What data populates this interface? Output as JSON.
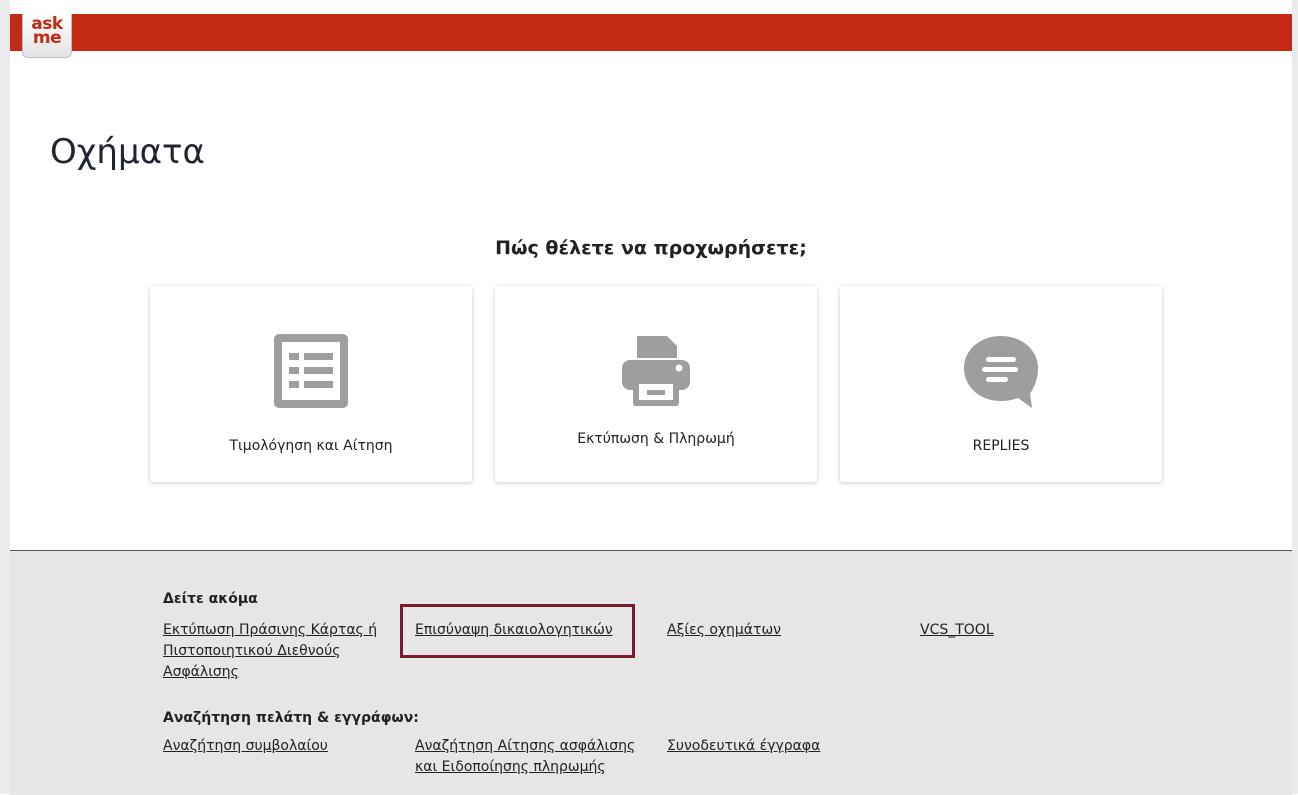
{
  "header": {
    "logo_text": "ask\nme",
    "brand_color": "#c52a16"
  },
  "page": {
    "title": "Οχήματα",
    "prompt": "Πώς θέλετε να προχωρήσετε;"
  },
  "cards": [
    {
      "label": "Τιμολόγηση και Αίτηση",
      "icon": "list-icon"
    },
    {
      "label": "Εκτύπωση & Πληρωμή",
      "icon": "printer-icon"
    },
    {
      "label": "REPLIES",
      "icon": "chat-bubble-icon"
    }
  ],
  "footer": {
    "see_also_heading": "Δείτε ακόμα",
    "see_also_links": [
      "Εκτύπωση Πράσινης Κάρτας ή Πιστοποιητικού Διεθνούς Ασφάλισης",
      "Επισύναψη δικαιολογητικών",
      "Αξίες οχημάτων",
      "VCS_TOOL"
    ],
    "search_heading": "Αναζήτηση πελάτη & εγγράφων:",
    "search_links": [
      "Αναζήτηση συμβολαίου",
      "Αναζήτηση Αίτησης ασφάλισης και Ειδοποίησης πληρωμής",
      "Συνοδευτικά έγγραφα"
    ],
    "highlight_color": "#7a1a2c"
  },
  "colors": {
    "icon_gray": "#9e9e9e",
    "footer_bg": "#e6e6e6"
  }
}
